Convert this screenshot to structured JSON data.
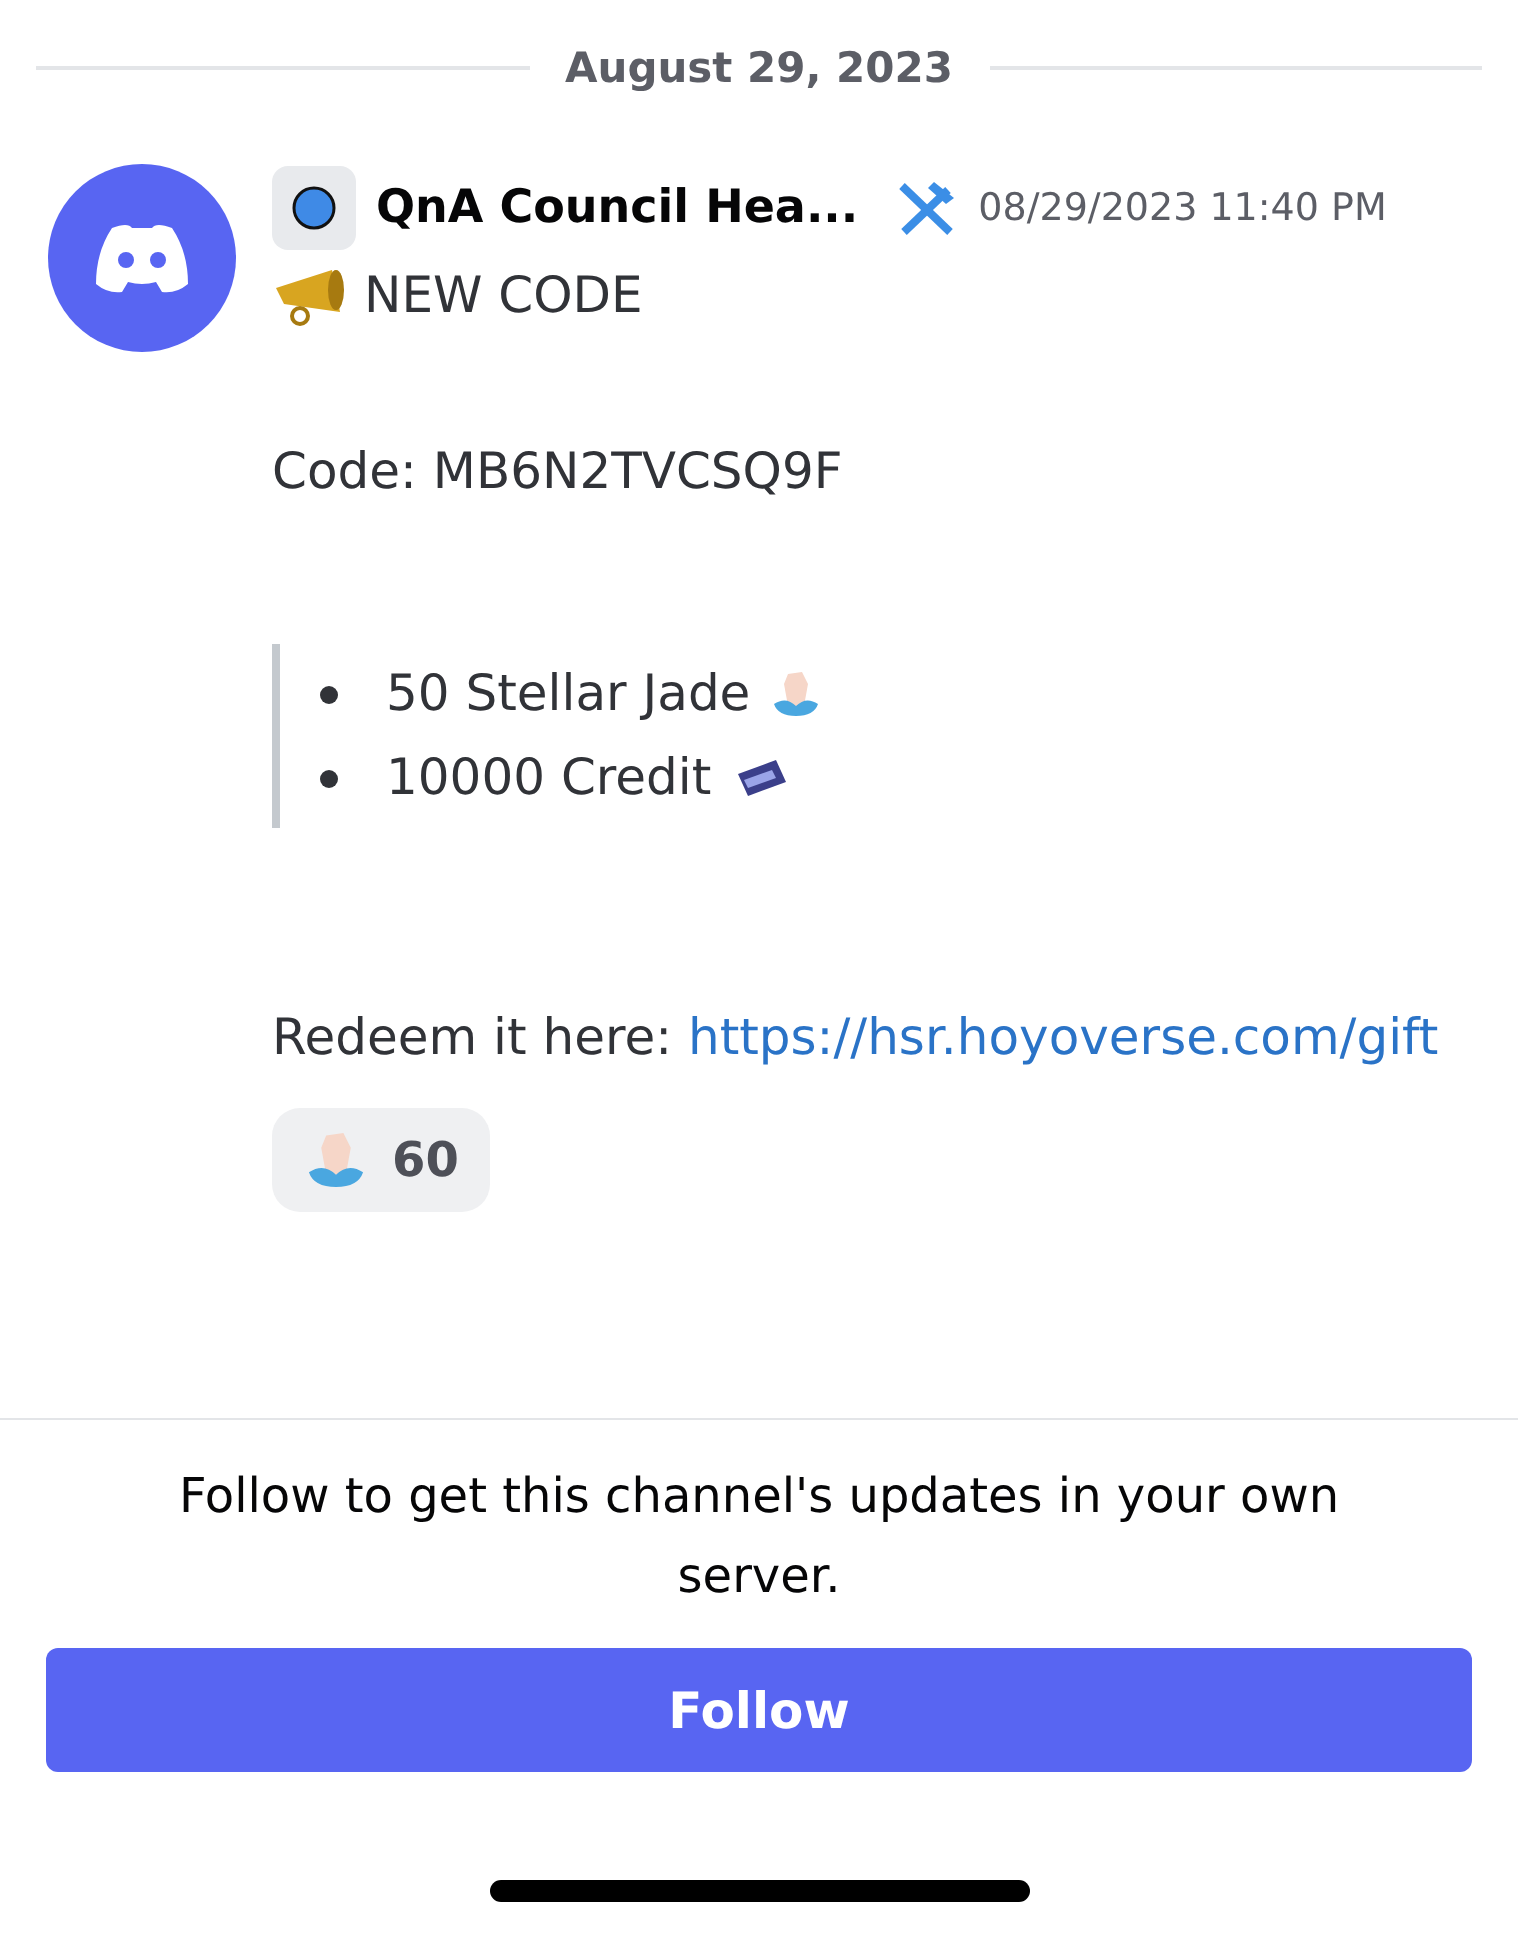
{
  "date_divider": "August 29, 2023",
  "message": {
    "author": "QnA Council Hea...",
    "timestamp": "08/29/2023 11:40 PM",
    "lines": [
      {
        "kind": "heading",
        "text": "NEW CODE"
      },
      {
        "kind": "text",
        "text": "Code: MB6N2TVCSQ9F"
      }
    ],
    "quote_items": [
      {
        "text": "50 Stellar Jade",
        "kind": "jade"
      },
      {
        "text": "10000 Credit",
        "kind": "credit"
      }
    ],
    "redeem": {
      "text": "Redeem it here:",
      "link": "https://hsr.hoyoverse.com/gift"
    },
    "reactions": [
      {
        "kind": "jade",
        "count": "60"
      }
    ]
  },
  "follow_prompt": "Follow to get this channel's updates in your own server.",
  "follow_button": "Follow"
}
